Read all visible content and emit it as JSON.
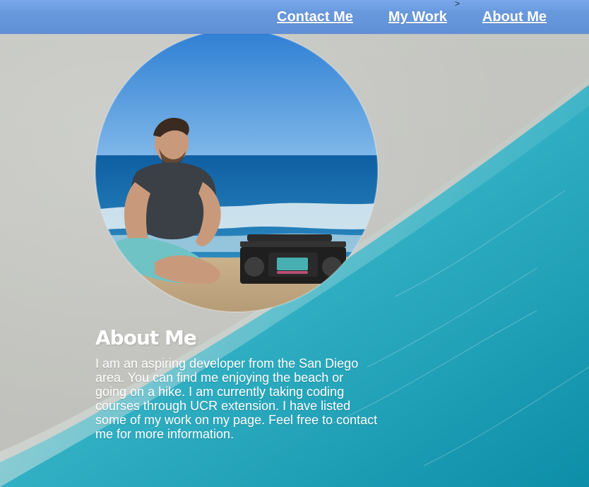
{
  "nav": {
    "caret": ">",
    "links": [
      {
        "label": "Contact Me"
      },
      {
        "label": "My Work"
      },
      {
        "label": "About Me"
      }
    ]
  },
  "profile": {
    "image_alt": "person sitting on beach with boombox"
  },
  "about": {
    "heading": "About Me",
    "body": "I am an aspiring developer from the San Diego area. You can find me enjoying the beach or going on a hike. I am currently taking coding courses through UCR extension. I have listed some of my work on my page. Feel free to contact me for more information."
  },
  "colors": {
    "nav_bg": "#5f8fd6",
    "sand": "#c5c6c1",
    "water": "#2aa7bf"
  }
}
